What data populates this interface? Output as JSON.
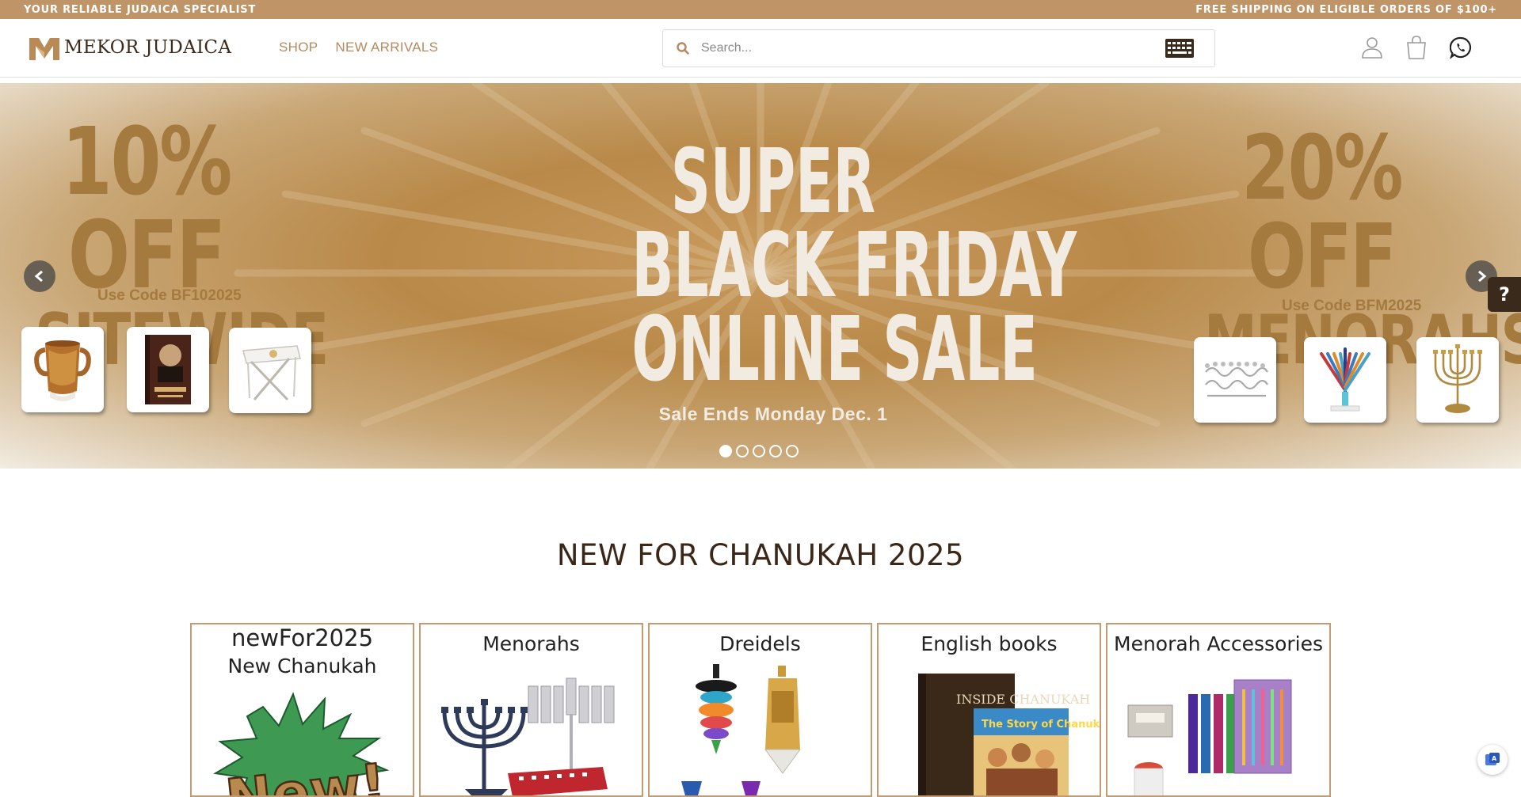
{
  "announcement": {
    "left": "YOUR RELIABLE JUDAICA SPECIALIST",
    "right": "FREE SHIPPING ON ELIGIBLE ORDERS OF $100+"
  },
  "header": {
    "logo_text": "MEKOR JUDAICA",
    "nav": [
      {
        "label": "SHOP"
      },
      {
        "label": "NEW ARRIVALS"
      }
    ],
    "search": {
      "placeholder": "Search..."
    },
    "icons": [
      "user-icon",
      "shopping-bag-icon",
      "whatsapp-icon"
    ]
  },
  "hero": {
    "left_offer_line1": "10% OFF",
    "left_offer_line2": "SITEWIDE",
    "left_code": "Use Code BF102025",
    "title_line1": "SUPER",
    "title_line2": "BLACK FRIDAY",
    "title_line3": "ONLINE SALE",
    "sale_ends": "Sale Ends Monday Dec. 1",
    "right_offer_line1": "20% OFF",
    "right_offer_line2": "MENORAHS",
    "right_code": "Use Code BFM2025",
    "slides_count": 5,
    "active_slide": 1,
    "left_thumbs": [
      "washing-cup",
      "book",
      "folding-tray"
    ],
    "right_thumbs": [
      "silver-menorah",
      "colored-menorah",
      "brass-menorah"
    ]
  },
  "help_label": "?",
  "section": {
    "title": "NEW FOR CHANUKAH 2025",
    "categories": [
      {
        "title": "newFor2025",
        "subtitle": "New Chanukah",
        "image": "new-burst"
      },
      {
        "title": "Menorahs",
        "image": "menorahs"
      },
      {
        "title": "Dreidels",
        "image": "dreidels"
      },
      {
        "title": "English books",
        "image": "books"
      },
      {
        "title": "Menorah Accessories",
        "image": "candles"
      }
    ]
  },
  "book_texts": {
    "inside_book": "INSIDE CHANUKAH",
    "story_book": "The Story of Chanukah"
  },
  "colors": {
    "accent": "#bf9466",
    "nav_text": "#b58a5e",
    "card_border": "#c49a70",
    "title_text": "#3b2717"
  }
}
